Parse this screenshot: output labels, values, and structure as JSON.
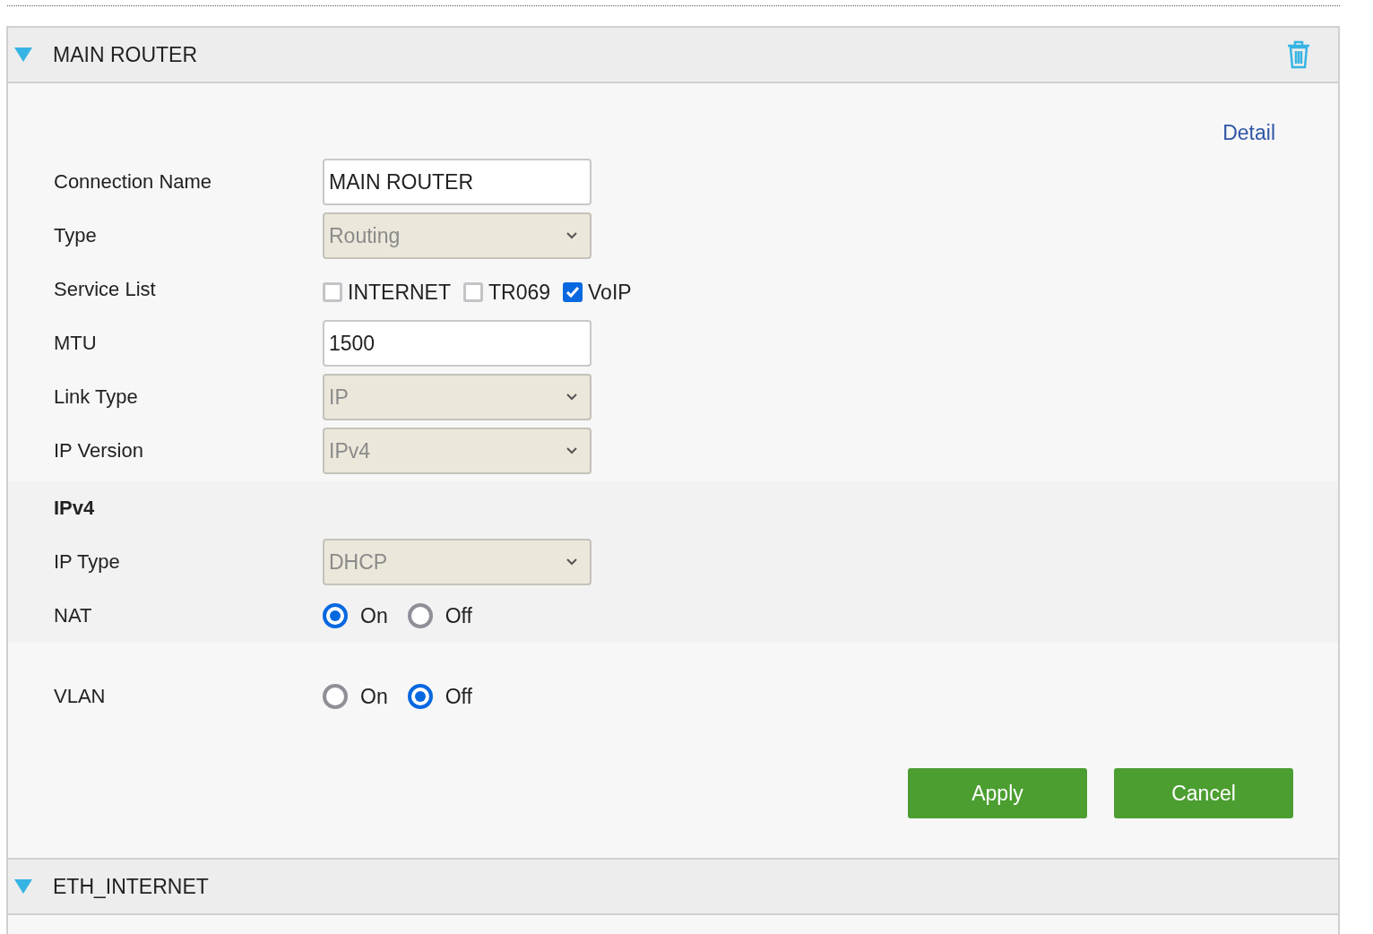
{
  "sections": [
    {
      "title": "MAIN ROUTER",
      "expanded": true,
      "detail_link": "Detail",
      "groups": [
        {
          "shaded": false,
          "fields": [
            {
              "kind": "text",
              "label": "Connection Name",
              "value": "MAIN ROUTER"
            },
            {
              "kind": "select",
              "label": "Type",
              "value": "Routing",
              "disabled": true
            },
            {
              "kind": "checkboxes",
              "label": "Service List",
              "options": [
                {
                  "label": "INTERNET",
                  "checked": false
                },
                {
                  "label": "TR069",
                  "checked": false
                },
                {
                  "label": "VoIP",
                  "checked": true
                }
              ]
            },
            {
              "kind": "text",
              "label": "MTU",
              "value": "1500"
            },
            {
              "kind": "select",
              "label": "Link Type",
              "value": "IP",
              "disabled": true
            },
            {
              "kind": "select",
              "label": "IP Version",
              "value": "IPv4",
              "disabled": true
            }
          ]
        },
        {
          "shaded": true,
          "heading": "IPv4",
          "fields": [
            {
              "kind": "select",
              "label": "IP Type",
              "value": "DHCP",
              "disabled": true
            },
            {
              "kind": "radios",
              "label": "NAT",
              "options": [
                {
                  "label": "On",
                  "selected": true
                },
                {
                  "label": "Off",
                  "selected": false
                }
              ]
            }
          ]
        },
        {
          "shaded": false,
          "fields": [
            {
              "kind": "radios",
              "label": "VLAN",
              "options": [
                {
                  "label": "On",
                  "selected": false
                },
                {
                  "label": "Off",
                  "selected": true
                }
              ]
            }
          ]
        }
      ],
      "buttons": [
        "Apply",
        "Cancel"
      ]
    },
    {
      "title": "ETH_INTERNET",
      "expanded": true
    }
  ]
}
